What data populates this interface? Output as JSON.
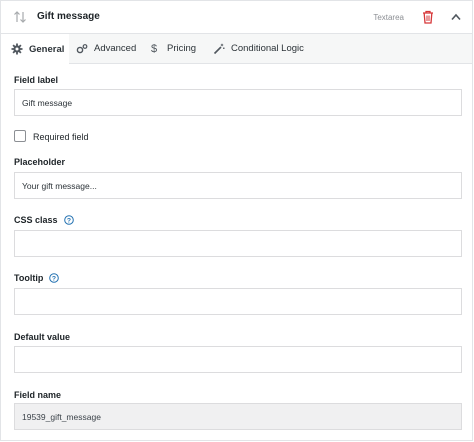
{
  "header": {
    "title": "Gift message",
    "type_label": "Textarea",
    "icons": {
      "sort": "sort-arrows-icon",
      "delete": "trash-icon",
      "collapse": "chevron-up-icon"
    },
    "delete_color": "#d63638"
  },
  "tabs": [
    {
      "label": "General",
      "icon": "gear-icon",
      "active": true
    },
    {
      "label": "Advanced",
      "icon": "gears-icon",
      "active": false
    },
    {
      "label": "Pricing",
      "icon": "dollar-icon",
      "active": false
    },
    {
      "label": "Conditional Logic",
      "icon": "magic-wand-icon",
      "active": false
    }
  ],
  "form": {
    "field_label": {
      "label": "Field label",
      "value": "Gift message"
    },
    "required": {
      "label": "Required field",
      "checked": false
    },
    "placeholder": {
      "label": "Placeholder",
      "value": "Your gift message..."
    },
    "css_class": {
      "label": "CSS class",
      "value": ""
    },
    "tooltip": {
      "label": "Tooltip",
      "value": ""
    },
    "default_value": {
      "label": "Default value",
      "value": ""
    },
    "field_name": {
      "label": "Field name",
      "value": "19539_gift_message"
    }
  },
  "colors": {
    "help_icon": "#2271b1"
  }
}
